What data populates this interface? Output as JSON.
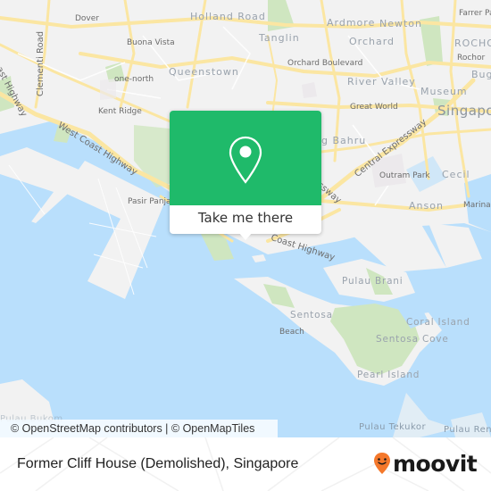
{
  "map": {
    "colors": {
      "land": "#f2f2f2",
      "water": "#b9dffc",
      "park": "#cfe6c0",
      "road": "#fbe6a2",
      "road_minor": "#ffffff",
      "industrial": "#ece9ec"
    },
    "labels": {
      "dover": "Dover",
      "holland_road": "Holland Road",
      "ardmore": "Ardmore",
      "newton": "Newton",
      "farrer_park": "Farrer Park",
      "clementi_road": "Clementi Road",
      "buona_vista": "Buona Vista",
      "tanglin": "Tanglin",
      "orchard": "Orchard",
      "rochor_district": "ROCHOR",
      "rochor": "Rochor",
      "coast_highway_nw": "Coast Highway",
      "queenstown": "Queenstown",
      "orchard_boulevard": "Orchard Boulevard",
      "bugis": "Bugis",
      "one_north": "one-north",
      "river_valley": "River Valley",
      "museum": "Museum",
      "kent_ridge": "Kent Ridge",
      "great_world": "Great World",
      "singapore": "Singapore",
      "road_fragment": "Road",
      "west_coast_highway": "West Coast Highway",
      "tiong_bahru": "g Bahru",
      "central_expressway": "Central Expressway",
      "outram_park": "Outram Park",
      "cecil": "Cecil",
      "pasir_panjang": "Pasir Panjang",
      "expressway_fragment": "ssway",
      "anson": "Anson",
      "marina": "Marina",
      "coast_highway": "Coast Highway",
      "pulau_brani": "Pulau Brani",
      "sentosa": "Sentosa",
      "beach": "Beach",
      "coral_island": "Coral Island",
      "sentosa_cove": "Sentosa Cove",
      "pearl_island": "Pearl Island",
      "pulau_bukom": "Pulau Bukom",
      "pulau_tekukor": "Pulau Tekukor",
      "pulau_renggit": "Pulau Ren"
    }
  },
  "popup": {
    "icon": "map-pin-icon",
    "cta_label": "Take me there",
    "accent": "#1fba6a"
  },
  "attribution": "© OpenStreetMap contributors | © OpenMapTiles",
  "footer": {
    "place_name": "Former Cliff House (Demolished), Singapore",
    "brand": "moovit",
    "brand_icon": "moovit-smile-pin-icon",
    "brand_color": "#f4782b"
  }
}
